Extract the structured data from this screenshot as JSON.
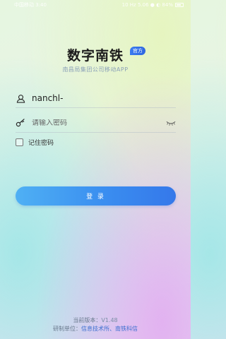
{
  "status_bar": {
    "carrier": "中国移动 3:40",
    "right_text": "10 Hz 5.06 ● ◐ 84%"
  },
  "app": {
    "title": "数字南铁",
    "badge": "官方",
    "subtitle": "南昌局集团公司移动APP"
  },
  "form": {
    "username_value": "nanchl-",
    "password_placeholder": "请输入密码",
    "remember_label": "记住密码",
    "login_label": "登 录"
  },
  "footer": {
    "version_prefix": "当前版本：",
    "version": "V1.48",
    "unit_prefix": "研制单位：",
    "unit_value": "信息技术所、南铁科信"
  },
  "icons": {
    "user": "user-icon",
    "key": "key-icon",
    "eye": "eye-closed-icon"
  },
  "colors": {
    "accent": "#3a8ef0",
    "badge": "#3a7bf0"
  }
}
